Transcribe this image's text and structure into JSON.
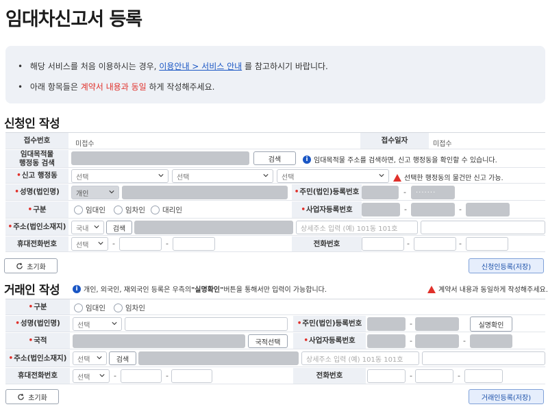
{
  "page_title": "임대차신고서 등록",
  "notice": {
    "line1_pre": "해당 서비스를 처음 이용하시는 경우, ",
    "line1_link": "이용안내 > 서비스 안내",
    "line1_post": "를 참고하시기 바랍니다.",
    "line2_pre": "아래 항목들은 ",
    "line2_red": "계약서 내용과 동일",
    "line2_post": "하게 작성해주세요."
  },
  "applicant": {
    "section_title": "신청인 작성",
    "receipt_no_label": "접수번호",
    "receipt_no_value": "미접수",
    "receipt_date_label": "접수일자",
    "receipt_date_value": "미접수",
    "property_label": "임대목적물\n행정동 검색",
    "search_button": "검색",
    "property_info": "임대목적물 주소를 검색하면, 신고 행정동을 확인할 수 있습니다.",
    "admin_dong_label": "신고 행정동",
    "select_placeholder": "선택",
    "admin_dong_warning": "선택한 행정동의 물건만 신고 가능.",
    "name_label": "성명(법인명)",
    "name_type": "개인",
    "resident_no_label": "주민(법인)등록번호",
    "resident_no_masked": "·······",
    "category_label": "구분",
    "radio_options": [
      "임대인",
      "임차인",
      "대리인"
    ],
    "biz_no_label": "사업자등록번호",
    "address_label": "주소(법인소재지)",
    "address_type": "국내",
    "address_detail_placeholder": "상세주소 입력 (예) 101동 101호",
    "mobile_label": "휴대전화번호",
    "phone_label": "전화번호",
    "reset_button": "초기화",
    "submit_button": "신청인등록(저장)"
  },
  "counterparty": {
    "section_title": "거래인 작성",
    "info_pre": "개인, 외국인, 재외국인 등록은 우측의 ",
    "info_bold": "\"실명확인\"",
    "info_post": " 버튼을 통해서만 입력이 가능합니다.",
    "warning": "계약서 내용과 동일하게 작성해주세요.",
    "category_label": "구분",
    "radio_options": [
      "임대인",
      "임차인"
    ],
    "name_label": "성명(법인명)",
    "select_placeholder": "선택",
    "resident_no_label": "주민(법인)등록번호",
    "verify_button": "실명확인",
    "nationality_label": "국적",
    "nationality_button": "국적선택",
    "biz_no_label": "사업자등록번호",
    "address_label": "주소(법인소재지)",
    "search_button": "검색",
    "address_detail_placeholder": "상세주소 입력 (예) 101동 101호",
    "mobile_label": "휴대전화번호",
    "phone_label": "전화번호",
    "reset_button": "초기화",
    "submit_button": "거래인등록(저장)"
  },
  "colors": {
    "accent": "#1a56c4",
    "warning": "#e0302a",
    "label_bg": "#edf0f5",
    "notice_bg": "#eef1f6"
  },
  "icons": {
    "info": "info-icon",
    "warning": "warning-icon",
    "reset": "refresh-icon",
    "dropdown": "chevron-down-icon",
    "bullet": "bullet-icon"
  }
}
